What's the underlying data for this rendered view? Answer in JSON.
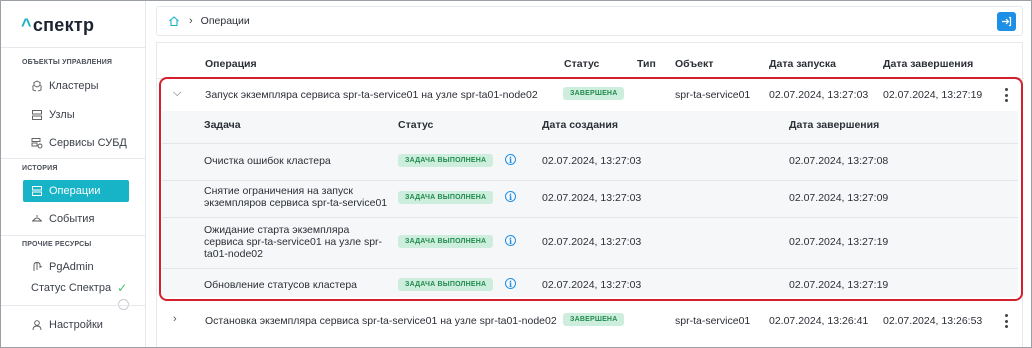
{
  "app": {
    "logo_text": "спектр"
  },
  "sidebar": {
    "sections": {
      "manage": "ОБЪЕКТЫ УПРАВЛЕНИЯ",
      "history": "ИСТОРИЯ",
      "other": "ПРОЧИЕ РЕСУРСЫ"
    },
    "items": [
      {
        "label": "Кластеры",
        "icon": "cluster-icon"
      },
      {
        "label": "Узлы",
        "icon": "server-icon"
      },
      {
        "label": "Сервисы СУБД",
        "icon": "database-settings-icon"
      },
      {
        "label": "Операции",
        "icon": "operations-icon",
        "active": true
      },
      {
        "label": "События",
        "icon": "events-icon"
      },
      {
        "label": "PgAdmin",
        "icon": "elephant-icon"
      },
      {
        "label": "Статус Спектра",
        "icon": "check-icon"
      },
      {
        "label": "Настройки",
        "icon": "user-icon"
      }
    ]
  },
  "breadcrumb": {
    "current": "Операции"
  },
  "table": {
    "headers": {
      "operation": "Операция",
      "status": "Статус",
      "type": "Тип",
      "object": "Объект",
      "start": "Дата запуска",
      "end": "Дата завершения"
    },
    "rows": [
      {
        "operation": "Запуск экземпляра сервиса spr-ta-service01 на узле spr-ta01-node02",
        "status": "ЗАВЕРШЕНА",
        "object": "spr-ta-service01",
        "start": "02.07.2024, 13:27:03",
        "end": "02.07.2024, 13:27:19",
        "expanded": true
      },
      {
        "operation": "Остановка экземпляра сервиса spr-ta-service01 на узле spr-ta01-node02",
        "status": "ЗАВЕРШЕНА",
        "object": "spr-ta-service01",
        "start": "02.07.2024, 13:26:41",
        "end": "02.07.2024, 13:26:53",
        "expanded": false
      }
    ],
    "subtable": {
      "headers": {
        "task": "Задача",
        "status": "Статус",
        "created": "Дата создания",
        "finished": "Дата завершения"
      },
      "tasks": [
        {
          "line1": "Очистка ошибок кластера",
          "line2": "",
          "line3": "",
          "status": "ЗАДАЧА ВЫПОЛНЕНА",
          "created": "02.07.2024, 13:27:03",
          "finished": "02.07.2024, 13:27:08"
        },
        {
          "line1": "Снятие ограничения на запуск",
          "line2": "экземпляров сервиса spr-ta-service01",
          "line3": "",
          "status": "ЗАДАЧА ВЫПОЛНЕНА",
          "created": "02.07.2024, 13:27:03",
          "finished": "02.07.2024, 13:27:09"
        },
        {
          "line1": "Ожидание старта экземпляра",
          "line2": "сервиса spr-ta-service01 на узле spr-",
          "line3": "ta01-node02",
          "status": "ЗАДАЧА ВЫПОЛНЕНА",
          "created": "02.07.2024, 13:27:03",
          "finished": "02.07.2024, 13:27:19"
        },
        {
          "line1": "Обновление статусов кластера",
          "line2": "",
          "line3": "",
          "status": "ЗАДАЧА ВЫПОЛНЕНА",
          "created": "02.07.2024, 13:27:03",
          "finished": "02.07.2024, 13:27:19"
        }
      ]
    }
  },
  "colors": {
    "accent": "#17b3c6",
    "badge_bg": "#cdeedd",
    "badge_text": "#228a4e",
    "highlight": "#d2202e",
    "primary_button": "#1e8fe6"
  }
}
